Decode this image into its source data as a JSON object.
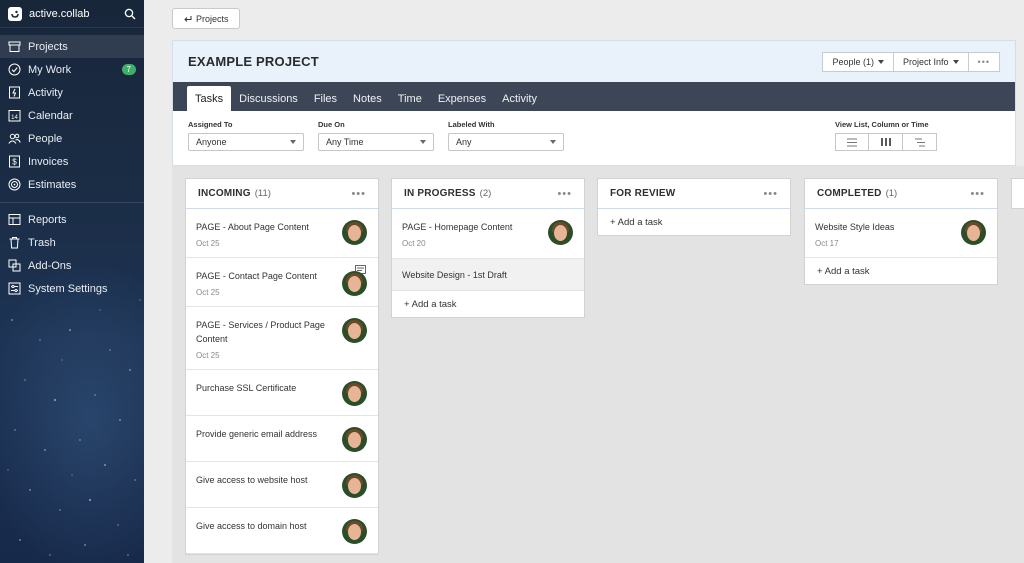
{
  "sidebar": {
    "brand": "active.collab",
    "nav_primary": [
      {
        "label": "Projects",
        "icon": "projects-icon",
        "active": true
      },
      {
        "label": "My Work",
        "icon": "check-circle-icon",
        "badge": "7"
      },
      {
        "label": "Activity",
        "icon": "activity-icon"
      },
      {
        "label": "Calendar",
        "icon": "calendar-icon",
        "icon_text": "14"
      },
      {
        "label": "People",
        "icon": "people-icon"
      },
      {
        "label": "Invoices",
        "icon": "invoice-icon"
      },
      {
        "label": "Estimates",
        "icon": "estimates-icon"
      }
    ],
    "nav_secondary": [
      {
        "label": "Reports",
        "icon": "reports-icon"
      },
      {
        "label": "Trash",
        "icon": "trash-icon"
      },
      {
        "label": "Add-Ons",
        "icon": "addons-icon"
      },
      {
        "label": "System Settings",
        "icon": "settings-icon"
      }
    ]
  },
  "back_button": {
    "label": "Projects",
    "icon": "return-arrow-icon"
  },
  "project": {
    "title": "EXAMPLE PROJECT",
    "people_button": "People (1)",
    "info_button": "Project Info",
    "more_button": "•••",
    "tabs": [
      "Tasks",
      "Discussions",
      "Files",
      "Notes",
      "Time",
      "Expenses",
      "Activity"
    ],
    "active_tab": "Tasks"
  },
  "filters": {
    "assigned_to": {
      "label": "Assigned To",
      "value": "Anyone"
    },
    "due_on": {
      "label": "Due On",
      "value": "Any Time"
    },
    "labeled_with": {
      "label": "Labeled With",
      "value": "Any"
    },
    "view_toggle": {
      "label": "View List, Column or Time",
      "active": "column"
    }
  },
  "board": {
    "add_task_label": "+ Add a task",
    "menu_glyph": "•••",
    "columns": [
      {
        "title": "INCOMING",
        "count": "(11)",
        "tasks": [
          {
            "title": "PAGE - About Page Content",
            "date": "Oct 25"
          },
          {
            "title": "PAGE - Contact Page Content",
            "date": "Oct 25"
          },
          {
            "title": "PAGE - Services / Product Page Content",
            "date": "Oct 25"
          },
          {
            "title": "Purchase SSL Certificate",
            "date": ""
          },
          {
            "title": "Provide generic email address",
            "date": ""
          },
          {
            "title": "Give access to website host",
            "date": ""
          },
          {
            "title": "Give access to domain host",
            "date": ""
          }
        ]
      },
      {
        "title": "IN PROGRESS",
        "count": "(2)",
        "tasks": [
          {
            "title": "PAGE - Homepage Content",
            "date": "Oct 20"
          },
          {
            "title": "Website Design - 1st Draft",
            "date": ""
          }
        ]
      },
      {
        "title": "FOR REVIEW",
        "count": "",
        "tasks": []
      },
      {
        "title": "COMPLETED",
        "count": "(1)",
        "tasks": [
          {
            "title": "Website Style Ideas",
            "date": "Oct 17"
          }
        ]
      }
    ]
  },
  "colors": {
    "accent_green": "#3fae6b",
    "tabbar": "#3c4657",
    "header_bg": "#e9f1fb"
  }
}
